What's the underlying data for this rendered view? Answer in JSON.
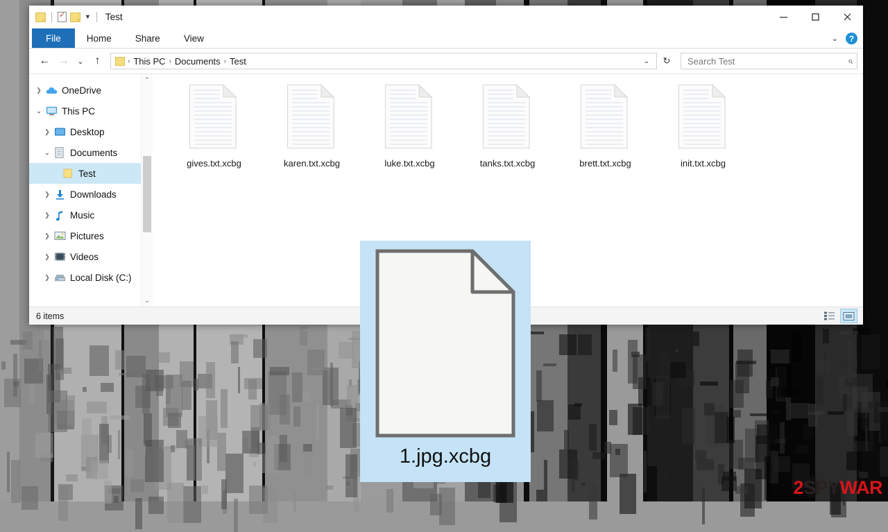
{
  "window": {
    "title": "Test",
    "quick_access": [
      {
        "name": "folder-icon",
        "label": ""
      },
      {
        "name": "properties-icon",
        "label": ""
      },
      {
        "name": "new-folder-icon",
        "label": ""
      },
      {
        "name": "customize-chevron-icon",
        "label": "▼"
      }
    ],
    "controls": {
      "minimize": "–",
      "maximize": "□",
      "close": "✕"
    }
  },
  "ribbon": {
    "tabs": [
      {
        "label": "File",
        "active": true
      },
      {
        "label": "Home",
        "active": false
      },
      {
        "label": "Share",
        "active": false
      },
      {
        "label": "View",
        "active": false
      }
    ],
    "collapse_chevron": "⌄",
    "help_label": "?"
  },
  "address": {
    "back": "←",
    "forward": "→",
    "recent": "⌄",
    "up": "↑",
    "crumbs": [
      "This PC",
      "Documents",
      "Test"
    ],
    "separator": "›",
    "dropdown": "⌄",
    "refresh": "↻"
  },
  "search": {
    "placeholder": "Search Test",
    "value": "",
    "icon": "search-icon"
  },
  "sidebar": {
    "items": [
      {
        "label": "OneDrive",
        "icon": "cloud-icon",
        "indent": 0,
        "twisty": "collapsed",
        "selected": false
      },
      {
        "label": "This PC",
        "icon": "monitor-icon",
        "indent": 0,
        "twisty": "expanded",
        "selected": false
      },
      {
        "label": "Desktop",
        "icon": "desktop-icon",
        "indent": 1,
        "twisty": "collapsed",
        "selected": false
      },
      {
        "label": "Documents",
        "icon": "document-icon",
        "indent": 1,
        "twisty": "expanded",
        "selected": false
      },
      {
        "label": "Test",
        "icon": "folder-icon",
        "indent": 2,
        "twisty": "none",
        "selected": true
      },
      {
        "label": "Downloads",
        "icon": "download-icon",
        "indent": 1,
        "twisty": "collapsed",
        "selected": false
      },
      {
        "label": "Music",
        "icon": "music-icon",
        "indent": 1,
        "twisty": "collapsed",
        "selected": false
      },
      {
        "label": "Pictures",
        "icon": "picture-icon",
        "indent": 1,
        "twisty": "collapsed",
        "selected": false
      },
      {
        "label": "Videos",
        "icon": "video-icon",
        "indent": 1,
        "twisty": "collapsed",
        "selected": false
      },
      {
        "label": "Local Disk (C:)",
        "icon": "drive-icon",
        "indent": 1,
        "twisty": "collapsed",
        "selected": false
      }
    ],
    "scroll_up": "⌃",
    "scroll_down": "⌄"
  },
  "files": [
    {
      "name": "gives.txt.xcbg",
      "icon": "text-file-icon"
    },
    {
      "name": "karen.txt.xcbg",
      "icon": "text-file-icon"
    },
    {
      "name": "luke.txt.xcbg",
      "icon": "text-file-icon"
    },
    {
      "name": "tanks.txt.xcbg",
      "icon": "text-file-icon"
    },
    {
      "name": "brett.txt.xcbg",
      "icon": "text-file-icon"
    },
    {
      "name": "init.txt.xcbg",
      "icon": "text-file-icon"
    }
  ],
  "status": {
    "item_count": "6 items",
    "views": [
      {
        "name": "details-view-button",
        "active": false
      },
      {
        "name": "large-icons-view-button",
        "active": true
      }
    ]
  },
  "zoom_card": {
    "filename": "1.jpg.xcbg",
    "icon": "blank-file-icon",
    "background": "#c5e2f7"
  },
  "watermark": {
    "part1": "2",
    "part2": "SPY",
    "part3": "WAR"
  },
  "colors": {
    "accent": "#1e6fb8",
    "selection": "#cce8f6",
    "zoom_bg": "#c5e2f7",
    "watermark_red": "#d8141a",
    "folder_yellow": "#f5dd7e"
  }
}
